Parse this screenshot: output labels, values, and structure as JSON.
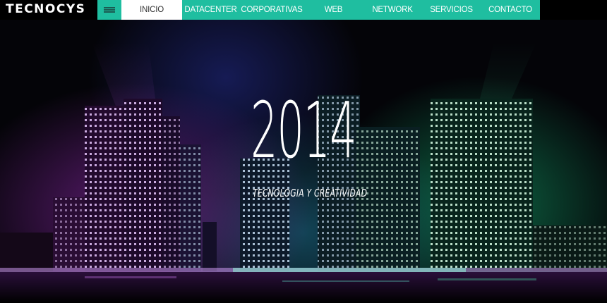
{
  "brand": {
    "logo_text": "TECNOCYS"
  },
  "nav": {
    "menu_icon": "hamburger-menu-icon",
    "items": [
      {
        "label": "INICIO",
        "active": true
      },
      {
        "label": "DATACENTER"
      },
      {
        "label": "CORPORATIVAS"
      },
      {
        "label": "WEB"
      },
      {
        "label": "NETWORK"
      },
      {
        "label": "SERVICIOS"
      },
      {
        "label": "CONTACTO"
      }
    ],
    "bar_color": "#1fbea0"
  },
  "hero": {
    "year": "2014",
    "tagline": "TECNOLOGIA Y CREATIVIDAD",
    "background": "night city skyline with purple, blue and green lights"
  }
}
